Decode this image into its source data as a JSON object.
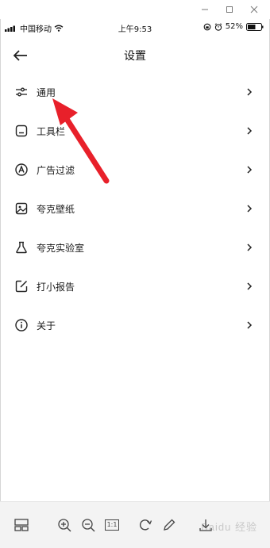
{
  "window": {
    "minimize_icon": "minimize-icon",
    "maximize_icon": "maximize-icon",
    "close_icon": "close-icon"
  },
  "status_bar": {
    "carrier": "中国移动",
    "time": "上午9:53",
    "battery": "52%"
  },
  "header": {
    "title": "设置"
  },
  "menu": {
    "items": [
      {
        "label": "通用",
        "icon": "sliders-icon"
      },
      {
        "label": "工具栏",
        "icon": "toolbar-icon"
      },
      {
        "label": "广告过滤",
        "icon": "ad-filter-icon"
      },
      {
        "label": "夸克壁纸",
        "icon": "wallpaper-icon"
      },
      {
        "label": "夸克实验室",
        "icon": "flask-icon"
      },
      {
        "label": "打小报告",
        "icon": "edit-report-icon"
      },
      {
        "label": "关于",
        "icon": "info-icon"
      }
    ]
  },
  "toolbar": {
    "zoom_reset_label": "1:1",
    "watermark": "Baidu 经验"
  },
  "colors": {
    "annotation_arrow": "#e8202a",
    "toolbar_bg": "#f3f3f3"
  }
}
